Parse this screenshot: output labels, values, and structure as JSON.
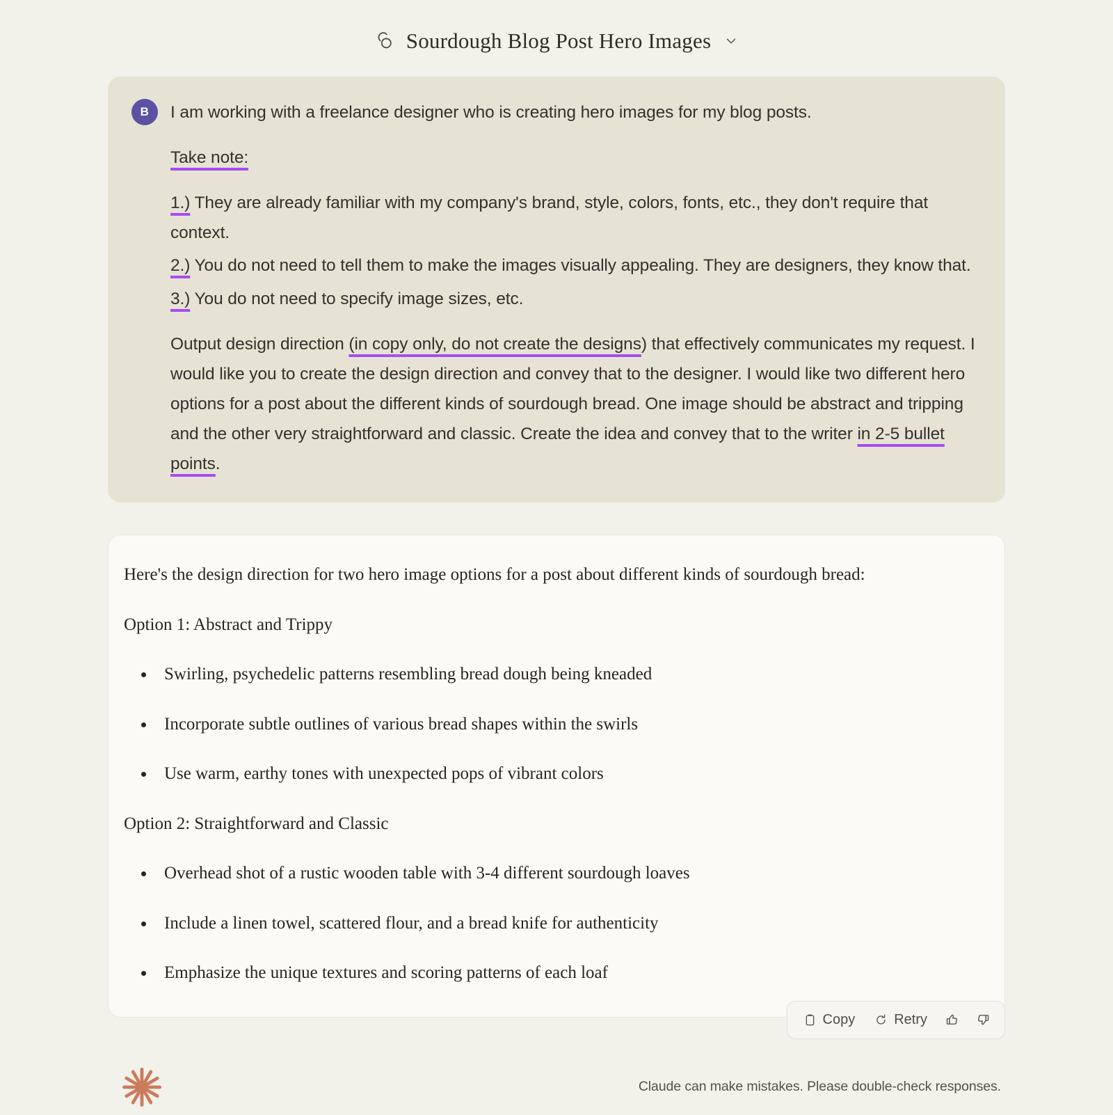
{
  "header": {
    "title": "Sourdough Blog Post Hero Images",
    "bubble_icon": "chat-bubble-icon",
    "chevron_icon": "chevron-down-icon"
  },
  "user_message": {
    "avatar_initial": "B",
    "avatar_color": "#5b52a3",
    "underline_color": "#a64df0",
    "bubble_color": "#e6e3d5",
    "paragraphs": [
      {
        "id": "intro",
        "text": "I am working with a freelance designer who is creating hero images for my blog posts."
      },
      {
        "id": "take-note",
        "text": "Take note:",
        "underlined": "Take note:"
      },
      {
        "id": "note-1",
        "marker": "1.)",
        "text": " They are already familiar with my company's brand, style, colors, fonts, etc., they don't require that context."
      },
      {
        "id": "note-2",
        "marker": "2.)",
        "text": "  You do not need to tell them to make the images visually appealing. They are designers, they know that."
      },
      {
        "id": "note-3",
        "marker": "3.)",
        "text": " You do not need to specify image sizes, etc."
      }
    ],
    "closing_paragraph": {
      "part_1": "Output design direction ",
      "underlined_1": "(in copy only, do not create the designs",
      "part_2": ") that effectively communicates my request. I would like you to create the design direction and convey that to the designer. I would like two different hero options for a post about the different kinds of sourdough bread. One image should be abstract and tripping and the other very straightforward and classic. Create the idea and convey that to the writer ",
      "underlined_2": "in 2-5 bullet points",
      "part_3": "."
    }
  },
  "assistant_message": {
    "intro": "Here's the design direction for two hero image options for a post about different kinds of sourdough bread:",
    "sections": [
      {
        "heading": "Option 1: Abstract and Trippy",
        "bullets": [
          "Swirling, psychedelic patterns resembling bread dough being kneaded",
          "Incorporate subtle outlines of various bread shapes within the swirls",
          "Use warm, earthy tones with unexpected pops of vibrant colors"
        ]
      },
      {
        "heading": "Option 2: Straightforward and Classic",
        "bullets": [
          "Overhead shot of a rustic wooden table with 3-4 different sourdough loaves",
          "Include a linen towel, scattered flour, and a bread knife for authenticity",
          "Emphasize the unique textures and scoring patterns of each loaf"
        ]
      }
    ]
  },
  "toolbar": {
    "copy_label": "Copy",
    "copy_icon": "clipboard-icon",
    "retry_label": "Retry",
    "retry_icon": "refresh-icon",
    "thumbs_up_icon": "thumbs-up-icon",
    "thumbs_down_icon": "thumbs-down-icon"
  },
  "footer": {
    "logo": "claude-starburst-logo",
    "logo_color": "#cc7b5c",
    "note": "Claude can make mistakes. Please double-check responses."
  }
}
